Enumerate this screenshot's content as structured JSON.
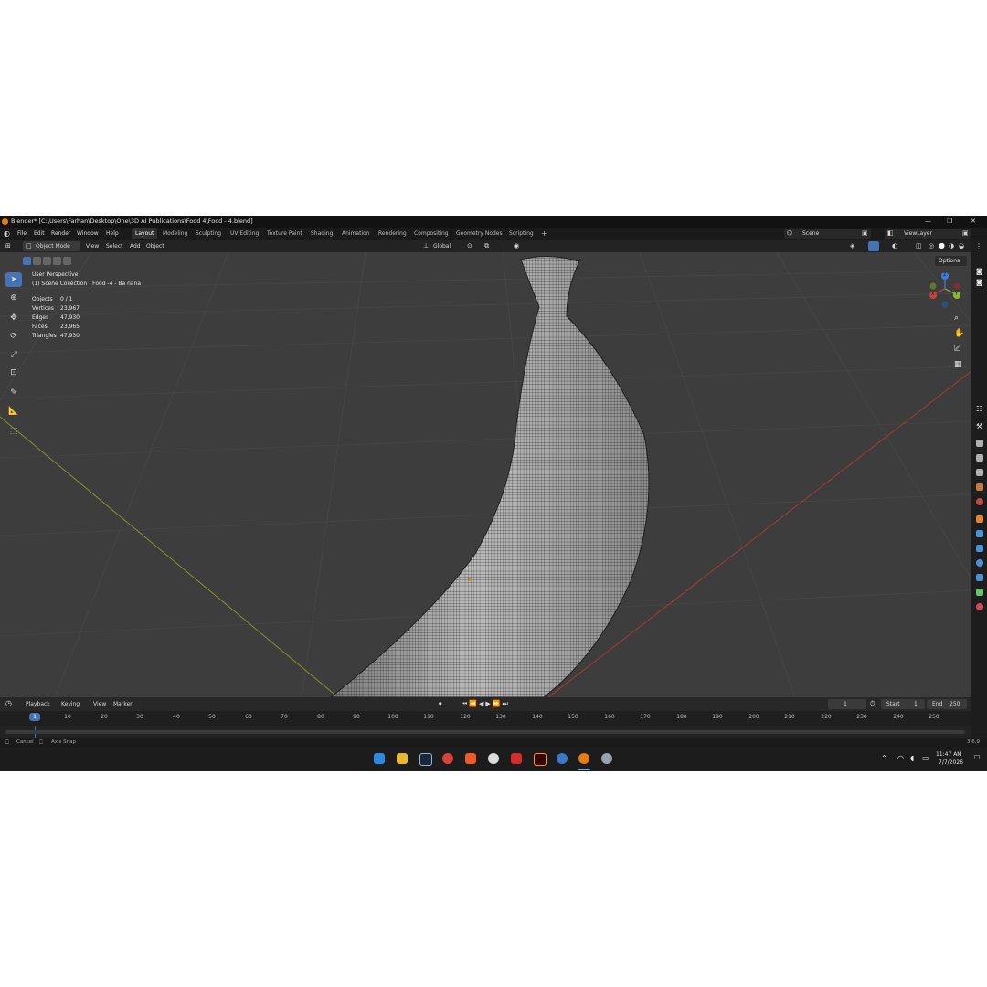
{
  "window": {
    "title": "Blender* [C:\\Users\\Farhan\\Desktop\\One\\3D AI Publications\\Food 4\\Food - 4.blend]",
    "controls": [
      "—",
      "❐",
      "✕"
    ]
  },
  "menu": [
    "File",
    "Edit",
    "Render",
    "Window",
    "Help"
  ],
  "workspaces": [
    "Layout",
    "Modeling",
    "Sculpting",
    "UV Editing",
    "Texture Paint",
    "Shading",
    "Animation",
    "Rendering",
    "Compositing",
    "Geometry Nodes",
    "Scripting",
    "+"
  ],
  "active_workspace": "Layout",
  "scene": {
    "label": "Scene",
    "view_layer": "ViewLayer"
  },
  "viewport_header": {
    "mode": "Object Mode",
    "menu": [
      "View",
      "Select",
      "Add",
      "Object"
    ],
    "transform_orientation": "Global",
    "options": "Options"
  },
  "viewport_info": {
    "perspective": "User Perspective",
    "collection": "(1) Scene Collection | Food -4 - Ba nana",
    "stats": [
      {
        "label": "Objects",
        "value": "0 / 1"
      },
      {
        "label": "Vertices",
        "value": "23,967"
      },
      {
        "label": "Edges",
        "value": "47,930"
      },
      {
        "label": "Faces",
        "value": "23,965"
      },
      {
        "label": "Triangles",
        "value": "47,930"
      }
    ]
  },
  "gizmo": {
    "z": "Z",
    "y": "Y",
    "x": "X"
  },
  "timeline": {
    "menu": [
      "Playback",
      "Keying",
      "View",
      "Marker"
    ],
    "current_frame": "1",
    "start_label": "Start",
    "start": "1",
    "end_label": "End",
    "end": "250",
    "ticks": [
      "1",
      "10",
      "20",
      "30",
      "40",
      "50",
      "60",
      "70",
      "80",
      "90",
      "100",
      "110",
      "120",
      "130",
      "140",
      "150",
      "160",
      "170",
      "180",
      "190",
      "200",
      "210",
      "220",
      "230",
      "240",
      "250"
    ]
  },
  "status": {
    "cancel": "Cancel",
    "axis_snap": "Axis Snap",
    "version": "3.6.9"
  },
  "taskbar": {
    "time": "11:47 AM",
    "date": "7/7/2026"
  },
  "colors": {
    "accent": "#4772b3",
    "x_axis": "#c9413e",
    "y_axis": "#8cb63c",
    "z_axis": "#3d7de0",
    "logo": "#e87d0d"
  }
}
